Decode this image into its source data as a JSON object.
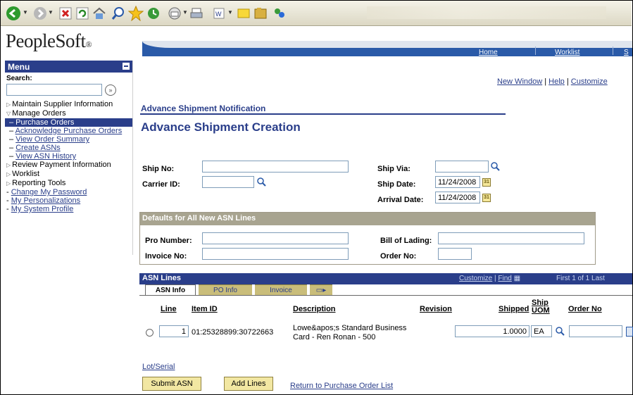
{
  "toolbar": {
    "icons": [
      "back-icon",
      "forward-icon",
      "stop-icon",
      "refresh-icon",
      "home-icon",
      "search-icon",
      "favorites-icon",
      "history-icon",
      "mail-icon",
      "print-icon",
      "edit-icon",
      "discuss-icon",
      "folder-icon",
      "messenger-icon"
    ]
  },
  "header": {
    "logo": "PeopleSoft",
    "nav": [
      "Home",
      "Worklist",
      "S"
    ],
    "toplinks": {
      "new_window": "New Window",
      "help": "Help",
      "customize": "Customize"
    }
  },
  "menu": {
    "title": "Menu",
    "search_label": "Search:",
    "search_value": "",
    "go": "»",
    "items": {
      "maintain": "Maintain Supplier Information",
      "manage": "Manage Orders",
      "purchase_orders": "– Purchase Orders",
      "acknowledge": "Acknowledge Purchase Orders",
      "view_order": "View Order Summary",
      "create_asns": "Create ASNs",
      "view_asn": "View ASN History",
      "review_payment": "Review Payment Information",
      "worklist": "Worklist",
      "reporting": "Reporting Tools",
      "change_pw": "Change My Password",
      "personalizations": "My Personalizations",
      "system_profile": "My System Profile"
    }
  },
  "page": {
    "breadcrumb": "Advance Shipment Notification",
    "title": "Advance Shipment Creation",
    "ship_no_label": "Ship No:",
    "ship_no_value": "",
    "carrier_label": "Carrier ID:",
    "carrier_value": "",
    "ship_via_label": "Ship Via:",
    "ship_via_value": "",
    "ship_date_label": "Ship Date:",
    "ship_date_value": "11/24/2008",
    "arrival_label": "Arrival Date:",
    "arrival_value": "11/24/2008"
  },
  "defaults": {
    "title": "Defaults for All New ASN Lines",
    "pro_label": "Pro Number:",
    "pro_value": "",
    "invoice_label": "Invoice No:",
    "invoice_value": "",
    "bol_label": "Bill of Lading:",
    "bol_value": "",
    "order_label": "Order No:",
    "order_value": ""
  },
  "grid": {
    "title": "ASN Lines",
    "customize": "Customize",
    "find": "Find",
    "nav": "First  1 of 1  Last",
    "tabs": [
      "ASN Info",
      "PO Info",
      "Invoice"
    ],
    "columns": {
      "line": "Line",
      "item": "Item ID",
      "desc": "Description",
      "revision": "Revision",
      "shipped": "Shipped",
      "ship_uom_1": "Ship",
      "ship_uom_2": "UOM",
      "order_no": "Order No"
    },
    "row": {
      "line": "1",
      "item": "01:25328899:30722663",
      "desc1": "Lowe&apos;s Standard Business",
      "desc2": "Card - Ren Ronan - 500",
      "shipped": "1.0000",
      "uom": "EA",
      "order_no": ""
    }
  },
  "footer": {
    "lot_serial": "Lot/Serial",
    "submit": "Submit ASN",
    "add_lines": "Add Lines",
    "return": "Return to Purchase Order List"
  }
}
